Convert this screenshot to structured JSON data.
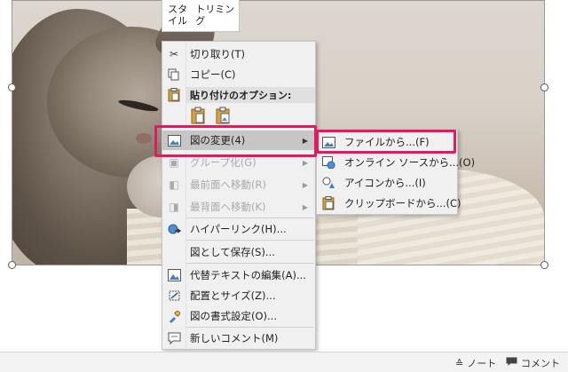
{
  "mini_toolbar": {
    "style": "スタイル",
    "trim": "トリミング"
  },
  "context_menu": {
    "items": [
      {
        "label": "切り取り(T)",
        "icon": "scissors-icon"
      },
      {
        "label": "コピー(C)",
        "icon": "copy-icon"
      },
      {
        "section": "貼り付けのオプション:",
        "icons": [
          "paste-keep-icon",
          "paste-picture-icon"
        ]
      },
      {
        "label": "図の変更(4)",
        "icon": "change-picture-icon",
        "submenu": true,
        "highlighted": true
      },
      {
        "label": "グループ化(G)",
        "icon": "group-icon",
        "submenu": true,
        "disabled": true
      },
      {
        "label": "最前面へ移動(R)",
        "icon": "bring-front-icon",
        "submenu": true,
        "disabled": true
      },
      {
        "label": "最背面へ移動(K)",
        "icon": "send-back-icon",
        "submenu": true,
        "disabled": true
      },
      {
        "label": "ハイパーリンク(H)...",
        "icon": "hyperlink-icon"
      },
      {
        "label": "図として保存(S)...",
        "icon": ""
      },
      {
        "label": "代替テキストの編集(A)...",
        "icon": "alt-text-icon"
      },
      {
        "label": "配置とサイズ(Z)...",
        "icon": "size-position-icon"
      },
      {
        "label": "図の書式設定(O)...",
        "icon": "format-picture-icon"
      },
      {
        "label": "新しいコメント(M)",
        "icon": "new-comment-icon"
      }
    ]
  },
  "submenu": {
    "items": [
      {
        "label": "ファイルから...(F)",
        "icon": "from-file-icon"
      },
      {
        "label": "オンライン ソースから...(O)",
        "icon": "online-source-icon"
      },
      {
        "label": "アイコンから...(I)",
        "icon": "from-icons-icon"
      },
      {
        "label": "クリップボードから...(C)",
        "icon": "from-clipboard-icon"
      }
    ]
  },
  "status_bar": {
    "notes": "ノート",
    "comments": "コメント"
  },
  "colors": {
    "highlight_box": "#e5195f",
    "menu_bg": "#f0f0f0",
    "menu_hover": "#c6c6c6"
  }
}
